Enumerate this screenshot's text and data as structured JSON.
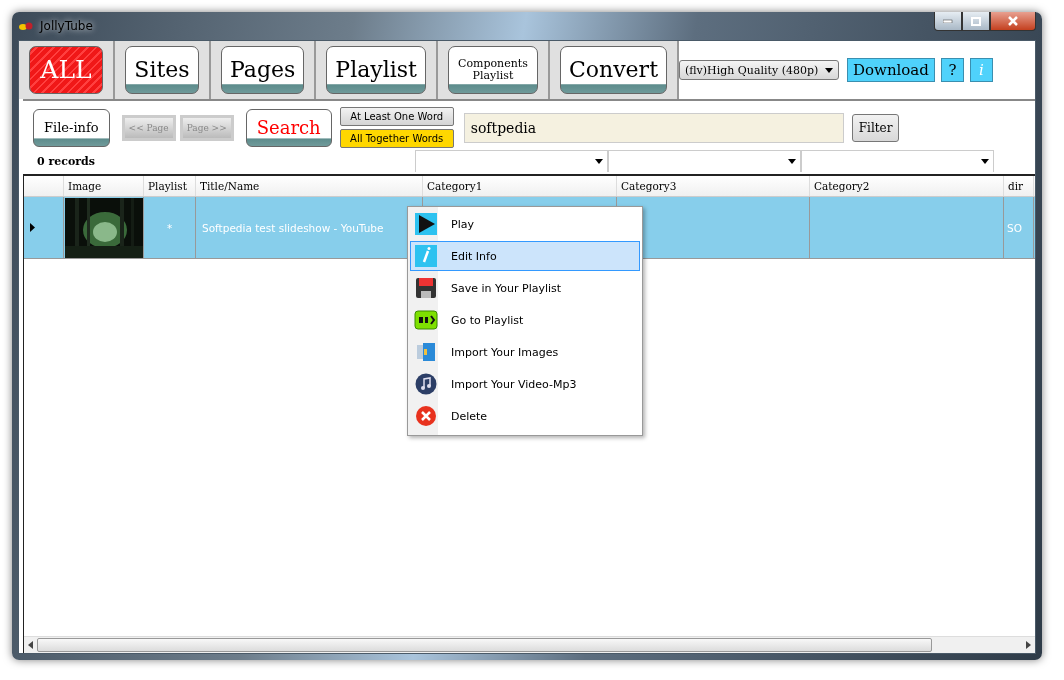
{
  "window": {
    "title": "JollyTube"
  },
  "tabs": [
    {
      "label": "ALL",
      "selected": true
    },
    {
      "label": "Sites",
      "selected": false
    },
    {
      "label": "Pages",
      "selected": false
    },
    {
      "label": "Playlist",
      "selected": false
    },
    {
      "label": "Components Playlist",
      "selected": false
    },
    {
      "label": "Convert",
      "selected": false
    }
  ],
  "quality": {
    "value": "(flv)High Quality (480p)"
  },
  "actions": [
    {
      "label": "Download",
      "kind": "text"
    },
    {
      "label": "?",
      "kind": "text"
    },
    {
      "label": "i",
      "kind": "italic"
    }
  ],
  "toolbar": {
    "file_info": "File-info",
    "prev_page": {
      "label": "<< Page",
      "disabled": true
    },
    "next_page": {
      "label": "Page >>",
      "disabled": true
    },
    "search": "Search",
    "match_modes": [
      {
        "label": "At Least One Word",
        "selected": false
      },
      {
        "label": "All Together Words",
        "selected": true
      }
    ],
    "search_field": {
      "value": "softpedia"
    },
    "filter": "Filter",
    "records": "0 records"
  },
  "table": {
    "columns": [
      "Image",
      "Playlist",
      "Title/Name",
      "Category1",
      "Category3",
      "Category2",
      "dir"
    ],
    "rows": [
      {
        "selected": true,
        "playlist": "*",
        "title": "Softpedia test slideshow - YouTube",
        "dir": "SO"
      }
    ]
  },
  "context_menu": {
    "items": [
      {
        "label": "Play",
        "kind": "play",
        "selected": false
      },
      {
        "label": "Edit Info",
        "kind": "info",
        "selected": true
      },
      {
        "label": "Save in Your Playlist",
        "kind": "save",
        "selected": false
      },
      {
        "label": "Go to Playlist",
        "kind": "go",
        "selected": false
      },
      {
        "label": "Import Your Images",
        "kind": "images",
        "selected": false
      },
      {
        "label": "Import Your Video-Mp3",
        "kind": "music",
        "selected": false
      },
      {
        "label": "Delete",
        "kind": "delete",
        "selected": false
      }
    ]
  }
}
